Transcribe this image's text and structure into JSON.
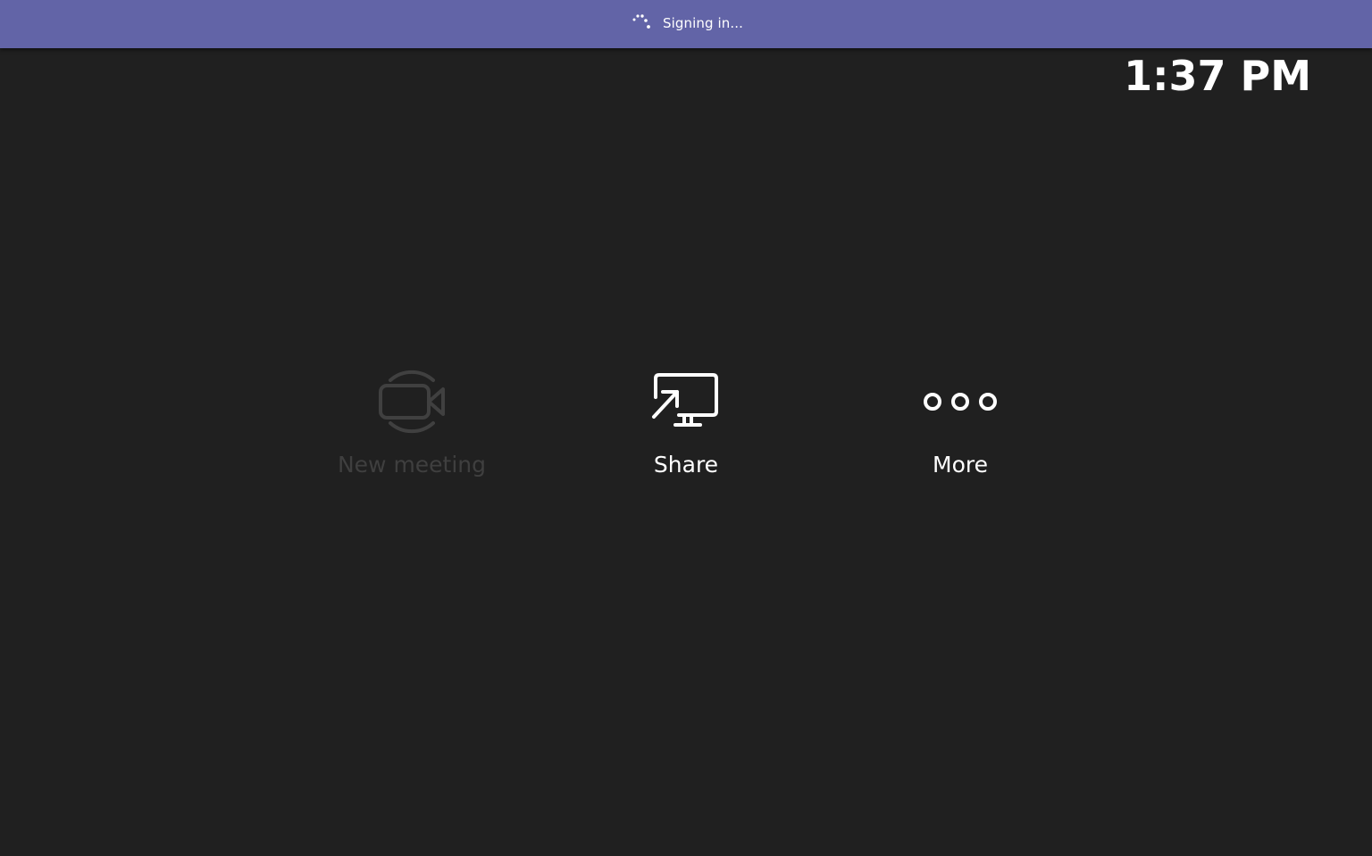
{
  "banner": {
    "status_text": "Signing in...",
    "color": "#6264a7",
    "icon": "loading-spinner-icon"
  },
  "clock": {
    "time": "1:37 PM"
  },
  "actions": [
    {
      "label": "New meeting",
      "icon": "video-camera-icon",
      "enabled": false
    },
    {
      "label": "Share",
      "icon": "share-screen-icon",
      "enabled": true
    },
    {
      "label": "More",
      "icon": "more-options-icon",
      "enabled": true
    }
  ],
  "colors": {
    "background": "#202020",
    "text": "#ffffff",
    "disabled": "#3f3f3f"
  }
}
